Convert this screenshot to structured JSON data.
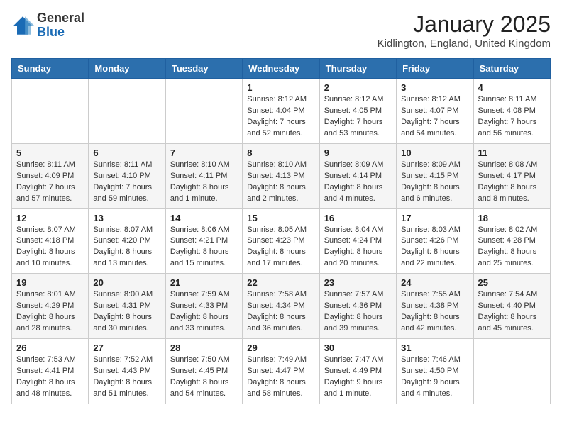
{
  "header": {
    "logo_general": "General",
    "logo_blue": "Blue",
    "month_title": "January 2025",
    "location": "Kidlington, England, United Kingdom"
  },
  "weekdays": [
    "Sunday",
    "Monday",
    "Tuesday",
    "Wednesday",
    "Thursday",
    "Friday",
    "Saturday"
  ],
  "weeks": [
    [
      {
        "day": "",
        "info": ""
      },
      {
        "day": "",
        "info": ""
      },
      {
        "day": "",
        "info": ""
      },
      {
        "day": "1",
        "info": "Sunrise: 8:12 AM\nSunset: 4:04 PM\nDaylight: 7 hours and 52 minutes."
      },
      {
        "day": "2",
        "info": "Sunrise: 8:12 AM\nSunset: 4:05 PM\nDaylight: 7 hours and 53 minutes."
      },
      {
        "day": "3",
        "info": "Sunrise: 8:12 AM\nSunset: 4:07 PM\nDaylight: 7 hours and 54 minutes."
      },
      {
        "day": "4",
        "info": "Sunrise: 8:11 AM\nSunset: 4:08 PM\nDaylight: 7 hours and 56 minutes."
      }
    ],
    [
      {
        "day": "5",
        "info": "Sunrise: 8:11 AM\nSunset: 4:09 PM\nDaylight: 7 hours and 57 minutes."
      },
      {
        "day": "6",
        "info": "Sunrise: 8:11 AM\nSunset: 4:10 PM\nDaylight: 7 hours and 59 minutes."
      },
      {
        "day": "7",
        "info": "Sunrise: 8:10 AM\nSunset: 4:11 PM\nDaylight: 8 hours and 1 minute."
      },
      {
        "day": "8",
        "info": "Sunrise: 8:10 AM\nSunset: 4:13 PM\nDaylight: 8 hours and 2 minutes."
      },
      {
        "day": "9",
        "info": "Sunrise: 8:09 AM\nSunset: 4:14 PM\nDaylight: 8 hours and 4 minutes."
      },
      {
        "day": "10",
        "info": "Sunrise: 8:09 AM\nSunset: 4:15 PM\nDaylight: 8 hours and 6 minutes."
      },
      {
        "day": "11",
        "info": "Sunrise: 8:08 AM\nSunset: 4:17 PM\nDaylight: 8 hours and 8 minutes."
      }
    ],
    [
      {
        "day": "12",
        "info": "Sunrise: 8:07 AM\nSunset: 4:18 PM\nDaylight: 8 hours and 10 minutes."
      },
      {
        "day": "13",
        "info": "Sunrise: 8:07 AM\nSunset: 4:20 PM\nDaylight: 8 hours and 13 minutes."
      },
      {
        "day": "14",
        "info": "Sunrise: 8:06 AM\nSunset: 4:21 PM\nDaylight: 8 hours and 15 minutes."
      },
      {
        "day": "15",
        "info": "Sunrise: 8:05 AM\nSunset: 4:23 PM\nDaylight: 8 hours and 17 minutes."
      },
      {
        "day": "16",
        "info": "Sunrise: 8:04 AM\nSunset: 4:24 PM\nDaylight: 8 hours and 20 minutes."
      },
      {
        "day": "17",
        "info": "Sunrise: 8:03 AM\nSunset: 4:26 PM\nDaylight: 8 hours and 22 minutes."
      },
      {
        "day": "18",
        "info": "Sunrise: 8:02 AM\nSunset: 4:28 PM\nDaylight: 8 hours and 25 minutes."
      }
    ],
    [
      {
        "day": "19",
        "info": "Sunrise: 8:01 AM\nSunset: 4:29 PM\nDaylight: 8 hours and 28 minutes."
      },
      {
        "day": "20",
        "info": "Sunrise: 8:00 AM\nSunset: 4:31 PM\nDaylight: 8 hours and 30 minutes."
      },
      {
        "day": "21",
        "info": "Sunrise: 7:59 AM\nSunset: 4:33 PM\nDaylight: 8 hours and 33 minutes."
      },
      {
        "day": "22",
        "info": "Sunrise: 7:58 AM\nSunset: 4:34 PM\nDaylight: 8 hours and 36 minutes."
      },
      {
        "day": "23",
        "info": "Sunrise: 7:57 AM\nSunset: 4:36 PM\nDaylight: 8 hours and 39 minutes."
      },
      {
        "day": "24",
        "info": "Sunrise: 7:55 AM\nSunset: 4:38 PM\nDaylight: 8 hours and 42 minutes."
      },
      {
        "day": "25",
        "info": "Sunrise: 7:54 AM\nSunset: 4:40 PM\nDaylight: 8 hours and 45 minutes."
      }
    ],
    [
      {
        "day": "26",
        "info": "Sunrise: 7:53 AM\nSunset: 4:41 PM\nDaylight: 8 hours and 48 minutes."
      },
      {
        "day": "27",
        "info": "Sunrise: 7:52 AM\nSunset: 4:43 PM\nDaylight: 8 hours and 51 minutes."
      },
      {
        "day": "28",
        "info": "Sunrise: 7:50 AM\nSunset: 4:45 PM\nDaylight: 8 hours and 54 minutes."
      },
      {
        "day": "29",
        "info": "Sunrise: 7:49 AM\nSunset: 4:47 PM\nDaylight: 8 hours and 58 minutes."
      },
      {
        "day": "30",
        "info": "Sunrise: 7:47 AM\nSunset: 4:49 PM\nDaylight: 9 hours and 1 minute."
      },
      {
        "day": "31",
        "info": "Sunrise: 7:46 AM\nSunset: 4:50 PM\nDaylight: 9 hours and 4 minutes."
      },
      {
        "day": "",
        "info": ""
      }
    ]
  ]
}
